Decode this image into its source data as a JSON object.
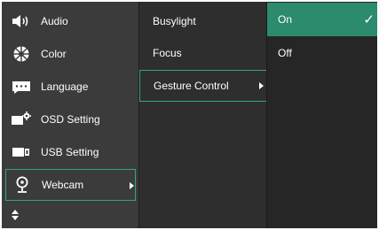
{
  "menu": {
    "items": [
      {
        "label": "Audio",
        "icon": "speaker-icon"
      },
      {
        "label": "Color",
        "icon": "color-wheel-icon"
      },
      {
        "label": "Language",
        "icon": "speech-bubble-icon"
      },
      {
        "label": "OSD Setting",
        "icon": "monitor-gear-icon"
      },
      {
        "label": "USB Setting",
        "icon": "usb-icon"
      },
      {
        "label": "Webcam",
        "icon": "webcam-icon"
      }
    ],
    "selected": "Webcam"
  },
  "submenu": {
    "items": [
      {
        "label": "Busylight"
      },
      {
        "label": "Focus"
      },
      {
        "label": "Gesture Control"
      }
    ],
    "selected": "Gesture Control"
  },
  "options": {
    "items": [
      {
        "label": "On"
      },
      {
        "label": "Off"
      }
    ],
    "selected": "On",
    "check_glyph": "✓"
  },
  "colors": {
    "accent": "#2fa58a",
    "active_option": "#2c8a6e"
  }
}
